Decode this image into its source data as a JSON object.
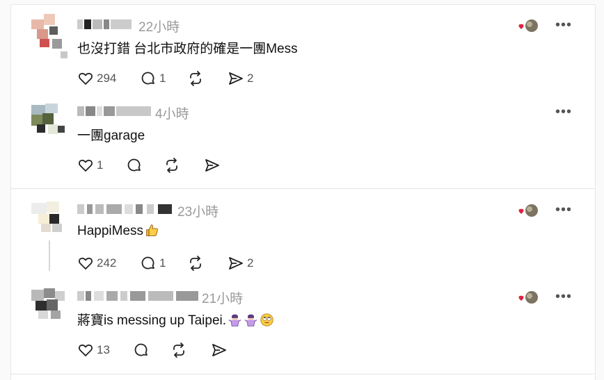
{
  "comments": [
    {
      "time": "22小時",
      "text": "也沒打錯 台北市政府的確是一團Mess",
      "likes": "294",
      "replies": "1",
      "reposts": "",
      "shares": "2",
      "badge": true
    },
    {
      "time": "4小時",
      "text": "一團garage",
      "likes": "1",
      "replies": "",
      "reposts": "",
      "shares": "",
      "badge": false
    },
    {
      "time": "23小時",
      "text": "HappiMess",
      "likes": "242",
      "replies": "1",
      "reposts": "",
      "shares": "2",
      "badge": true
    },
    {
      "time": "21小時",
      "text": "蔣寶is messing up Taipei.",
      "likes": "13",
      "replies": "",
      "reposts": "",
      "shares": "",
      "badge": true
    }
  ],
  "more_label": "•••",
  "icons": [
    "heart-icon",
    "comment-icon",
    "repost-icon",
    "share-icon",
    "more-icon",
    "reaction-avatar-icon"
  ],
  "colors": {
    "heart": "#e0223f",
    "muted": "#999999",
    "text": "#111111"
  }
}
